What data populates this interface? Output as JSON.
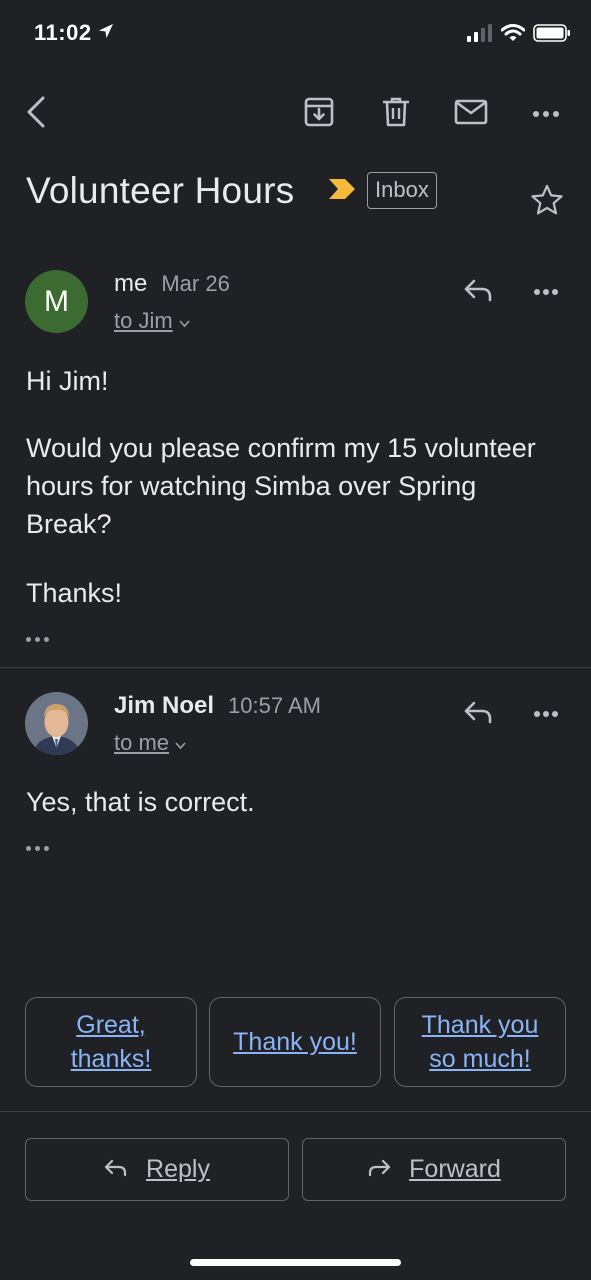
{
  "status": {
    "time": "11:02"
  },
  "thread": {
    "subject": "Volunteer Hours",
    "label": "Inbox"
  },
  "messages": [
    {
      "avatar_letter": "M",
      "avatar_color": "#3c6b32",
      "sender": "me",
      "date": "Mar 26",
      "recipient": "to Jim",
      "body": [
        "Hi Jim!",
        "Would you please confirm my 15 volunteer hours for watching Simba over Spring Break?",
        "Thanks!"
      ]
    },
    {
      "sender": "Jim Noel",
      "date": "10:57 AM",
      "recipient": "to me",
      "body": [
        "Yes, that is correct."
      ]
    }
  ],
  "smart_replies": [
    "Great, thanks!",
    "Thank you!",
    "Thank you so much!"
  ],
  "actions": {
    "reply": "Reply",
    "forward": "Forward"
  },
  "colors": {
    "background": "#202124",
    "accent": "#8ab4f8",
    "importance": "#f6b93b"
  }
}
